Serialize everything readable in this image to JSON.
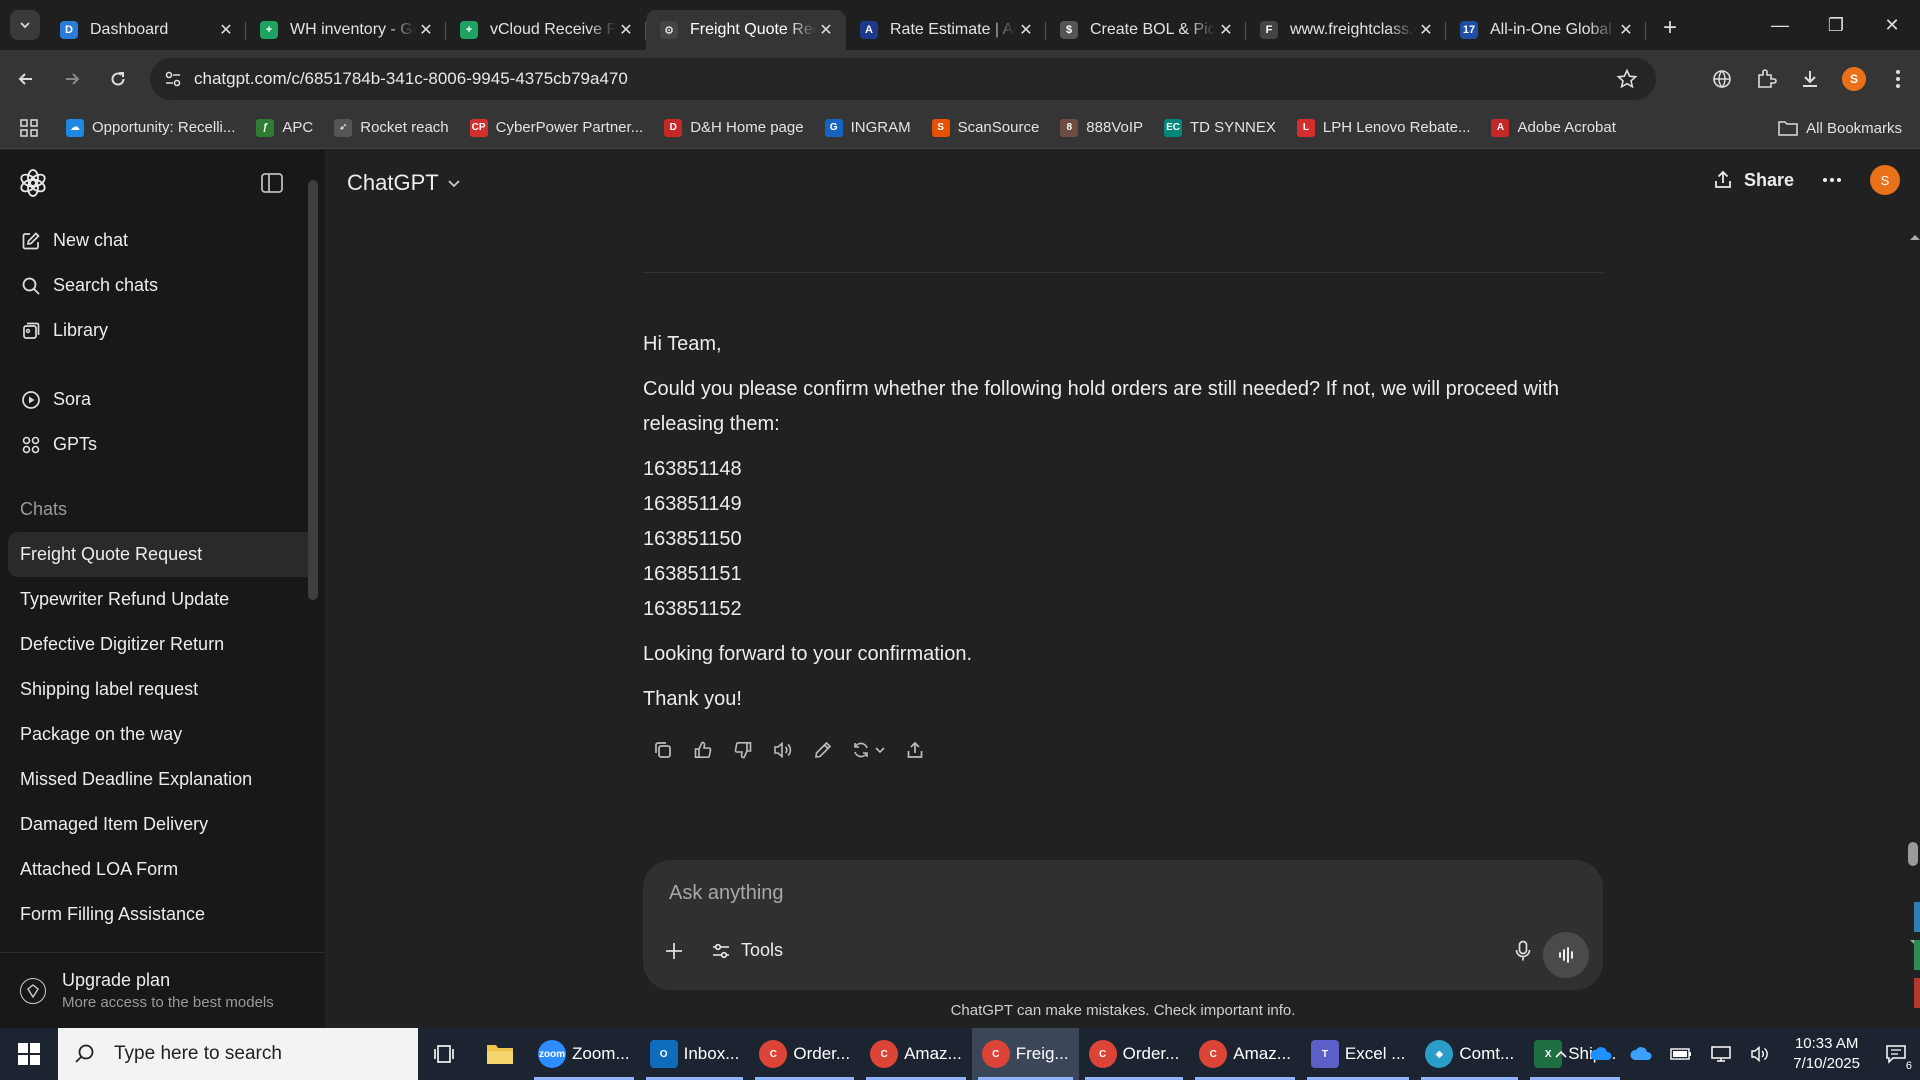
{
  "browser": {
    "tabs": [
      {
        "title": "Dashboard",
        "favicon": "D",
        "color": "#2b7bd8",
        "active": false
      },
      {
        "title": "WH inventory - Google Sheets",
        "favicon": "+",
        "color": "#1ea362",
        "active": false
      },
      {
        "title": "vCloud Receive Form",
        "favicon": "+",
        "color": "#1ea362",
        "active": false
      },
      {
        "title": "Freight Quote Request",
        "favicon": "⚙",
        "color": "#444444",
        "active": true
      },
      {
        "title": "Rate Estimate | ABF",
        "favicon": "A",
        "color": "#1d3a8a",
        "active": false
      },
      {
        "title": "Create BOL & Pickup",
        "favicon": "$",
        "color": "#555555",
        "active": false
      },
      {
        "title": "www.freightclass.com",
        "favicon": "F",
        "color": "#444444",
        "active": false
      },
      {
        "title": "All-in-One Global",
        "favicon": "17",
        "color": "#1e4fa3",
        "active": false
      }
    ],
    "url": "chatgpt.com/c/6851784b-341c-8006-9945-4375cb79a470",
    "profile_initial": "S",
    "bookmarks": [
      {
        "label": "Opportunity: Recelli...",
        "color": "#1e88e5",
        "glyph": "☁"
      },
      {
        "label": "APC",
        "color": "#2e7d32",
        "glyph": "ƒ"
      },
      {
        "label": "Rocket reach",
        "color": "#555555",
        "glyph": "➶"
      },
      {
        "label": "CyberPower Partner...",
        "color": "#d32f2f",
        "glyph": "CP"
      },
      {
        "label": "D&H Home page",
        "color": "#c62828",
        "glyph": "D"
      },
      {
        "label": "INGRAM",
        "color": "#1565c0",
        "glyph": "G"
      },
      {
        "label": "ScanSource",
        "color": "#e65100",
        "glyph": "S"
      },
      {
        "label": "888VoIP",
        "color": "#6d4c41",
        "glyph": "8"
      },
      {
        "label": "TD SYNNEX",
        "color": "#00897b",
        "glyph": "EC"
      },
      {
        "label": "LPH Lenovo Rebate...",
        "color": "#d32f2f",
        "glyph": "L"
      },
      {
        "label": "Adobe Acrobat",
        "color": "#c62828",
        "glyph": "A"
      }
    ],
    "all_bookmarks": "All Bookmarks"
  },
  "sidebar": {
    "nav": [
      {
        "label": "New chat",
        "icon": "compose-icon"
      },
      {
        "label": "Search chats",
        "icon": "search-icon"
      },
      {
        "label": "Library",
        "icon": "library-icon"
      }
    ],
    "nav2": [
      {
        "label": "Sora",
        "icon": "play-icon"
      },
      {
        "label": "GPTs",
        "icon": "grid-icon"
      }
    ],
    "section_title": "Chats",
    "chats": [
      "Freight Quote Request",
      "Typewriter Refund Update",
      "Defective Digitizer Return",
      "Shipping label request",
      "Package on the way",
      "Missed Deadline Explanation",
      "Damaged Item Delivery",
      "Attached LOA Form",
      "Form Filling Assistance"
    ],
    "upgrade": {
      "title": "Upgrade plan",
      "subtitle": "More access to the best models"
    }
  },
  "header": {
    "model": "ChatGPT",
    "share_label": "Share",
    "avatar_initial": "S"
  },
  "message": {
    "greeting": "Hi Team,",
    "body": "Could you please confirm whether the following hold orders are still needed? If not, we will proceed with releasing them:",
    "orders": [
      "163851148",
      "163851149",
      "163851150",
      "163851151",
      "163851152"
    ],
    "closing": "Looking forward to your confirmation.",
    "signoff": "Thank you!"
  },
  "composer": {
    "placeholder": "Ask anything",
    "tools_label": "Tools"
  },
  "disclaimer": "ChatGPT can make mistakes. Check important info.",
  "taskbar": {
    "search_placeholder": "Type here to search",
    "apps": [
      {
        "label": "Zoom...",
        "color": "#2d8cff",
        "glyph": "zoom"
      },
      {
        "label": "Inbox...",
        "color": "#0f6cbd",
        "glyph": "O"
      },
      {
        "label": "Order...",
        "color": "#db4437",
        "glyph": "C"
      },
      {
        "label": "Amaz...",
        "color": "#db4437",
        "glyph": "C"
      },
      {
        "label": "Freig...",
        "color": "#db4437",
        "glyph": "C"
      },
      {
        "label": "Order...",
        "color": "#db4437",
        "glyph": "C"
      },
      {
        "label": "Amaz...",
        "color": "#db4437",
        "glyph": "C"
      },
      {
        "label": "Excel ...",
        "color": "#5b5fc7",
        "glyph": "T"
      },
      {
        "label": "Comt...",
        "color": "#2a9ec9",
        "glyph": "◆"
      },
      {
        "label": "Ship...",
        "color": "#1d6f42",
        "glyph": "X"
      }
    ],
    "time": "10:33 AM",
    "date": "7/10/2025",
    "notifications": "6"
  }
}
